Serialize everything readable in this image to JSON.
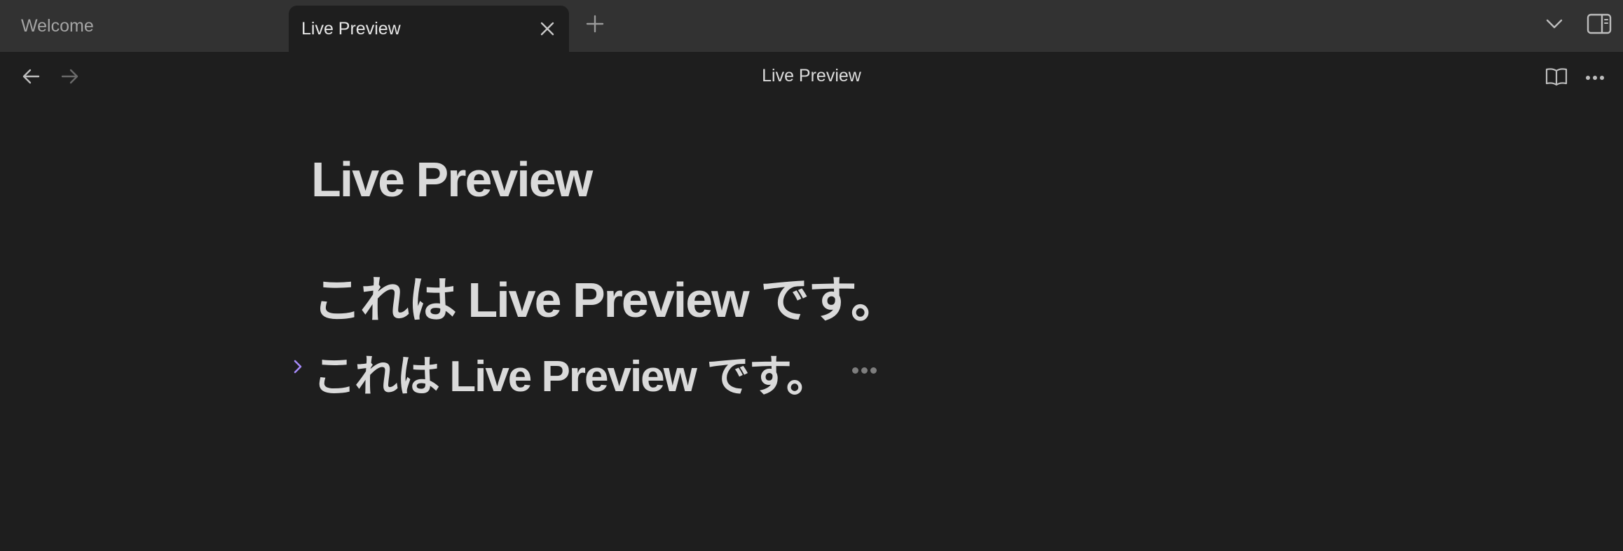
{
  "tabs": [
    {
      "label": "Welcome",
      "active": false
    },
    {
      "label": "Live Preview",
      "active": true
    }
  ],
  "tab_icons": {
    "close": "close-icon",
    "new_tab": "plus-icon",
    "tab_list": "chevron-down-icon",
    "sidebar": "sidebar-toggle-icon"
  },
  "header": {
    "title": "Live Preview",
    "icons": {
      "back": "arrow-left-icon",
      "forward": "arrow-right-icon",
      "reading_view": "book-open-icon",
      "more": "more-horizontal-icon"
    }
  },
  "editor": {
    "inline_title": "Live Preview",
    "heading1": "これは Live Preview です。",
    "heading2": "これは Live Preview です。",
    "heading2_folded": true,
    "fold_icon": "chevron-right-icon"
  },
  "colors": {
    "background": "#1e1e1e",
    "tabbar": "#323232",
    "text": "#dadada",
    "accent": "#a68af9",
    "muted_icon": "#7e7e7e"
  }
}
